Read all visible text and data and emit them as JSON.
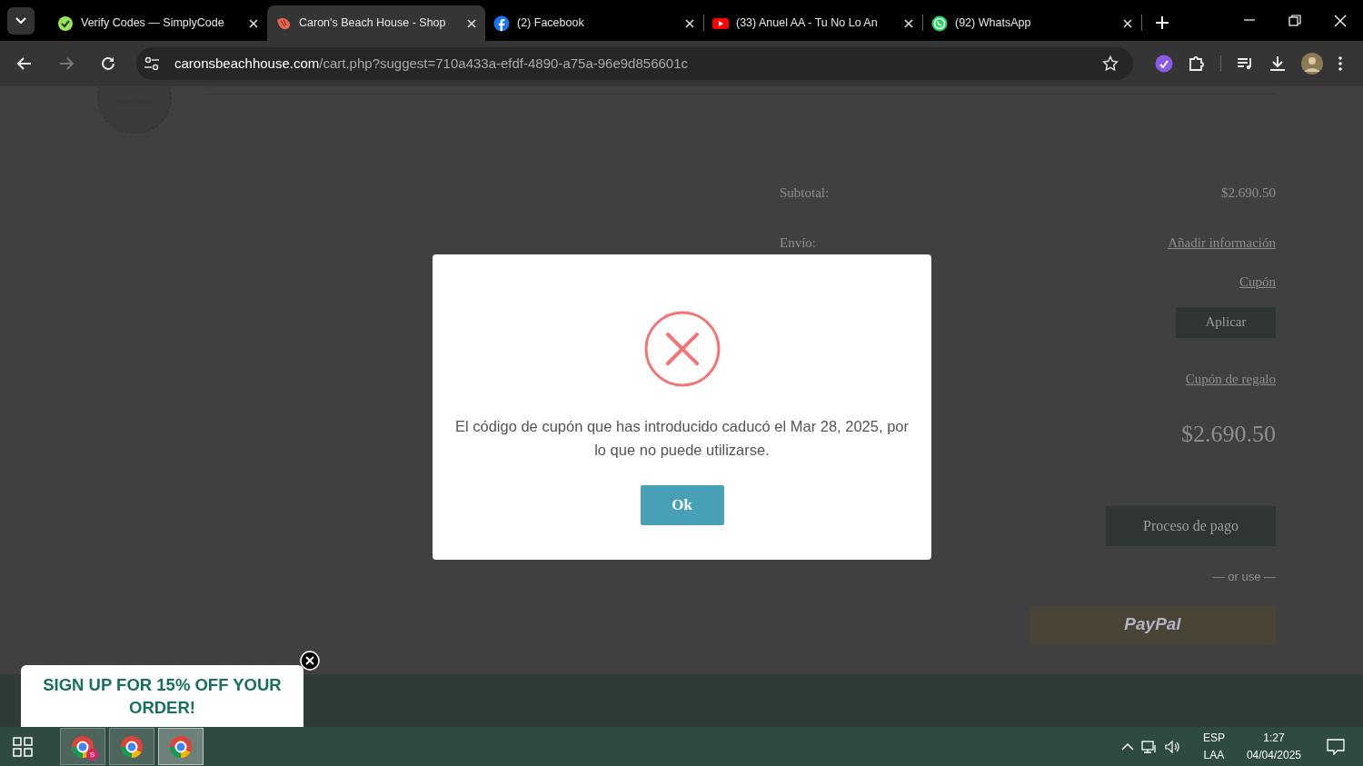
{
  "browser": {
    "tabs": [
      {
        "title": "Verify Codes — SimplyCode",
        "selected": false
      },
      {
        "title": "Caron's Beach House - Shop",
        "selected": true
      },
      {
        "title": "(2) Facebook",
        "selected": false
      },
      {
        "title": "(33) Anuel AA - Tu No Lo An",
        "selected": false
      },
      {
        "title": "(92) WhatsApp",
        "selected": false
      }
    ],
    "navigation": [
      {
        "kind": "back",
        "disabled": false
      },
      {
        "kind": "forward",
        "disabled": true
      },
      {
        "kind": "reload",
        "disabled": false
      }
    ],
    "address_bar": {
      "domain": "caronsbeachhouse.com",
      "path": "/cart.php?suggest=710a433a-efdf-4890-a75a-96e9d856601c"
    }
  },
  "cart_summary": {
    "rows": [
      {
        "label": "Subtotal:",
        "value": "$2.690.50",
        "kind": "text"
      },
      {
        "label": "Envío:",
        "value": "Añadir información",
        "kind": "link"
      }
    ],
    "coupon_link": "Cupón",
    "apply_button": "Aplicar",
    "gift_link": "Cupón de regalo",
    "total": "$2.690.50",
    "checkout_button": "Proceso de pago",
    "separator": "— or use —",
    "paypal_label": "PayPal"
  },
  "dialog": {
    "message": "El código de cupón que has introducido caducó el Mar 28, 2025, por lo que no puede utilizarse.",
    "button": "Ok"
  },
  "signup_popup": {
    "text": "SIGN UP FOR 15% OFF YOUR ORDER!"
  },
  "taskbar": {
    "apps": [
      {
        "badge": "S",
        "selected": false
      },
      {
        "selected": false
      },
      {
        "selected": true
      }
    ],
    "language": [
      "ESP",
      "LAA"
    ],
    "time": "1:27",
    "date": "04/04/2025"
  }
}
